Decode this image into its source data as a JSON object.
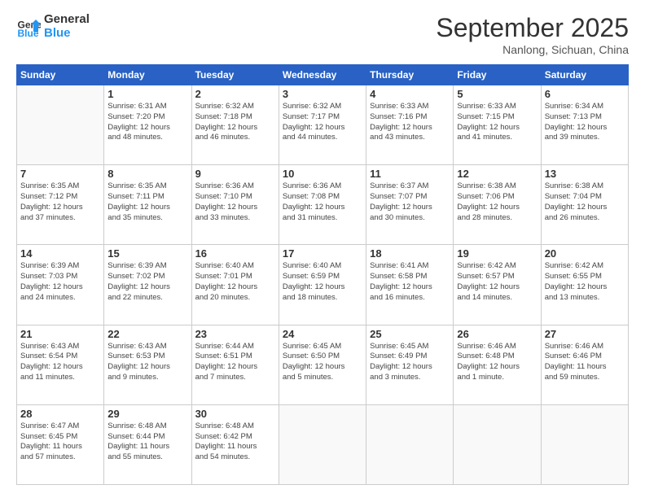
{
  "logo": {
    "line1": "General",
    "line2": "Blue"
  },
  "title": "September 2025",
  "location": "Nanlong, Sichuan, China",
  "weekdays": [
    "Sunday",
    "Monday",
    "Tuesday",
    "Wednesday",
    "Thursday",
    "Friday",
    "Saturday"
  ],
  "weeks": [
    [
      {
        "day": "",
        "info": ""
      },
      {
        "day": "1",
        "info": "Sunrise: 6:31 AM\nSunset: 7:20 PM\nDaylight: 12 hours\nand 48 minutes."
      },
      {
        "day": "2",
        "info": "Sunrise: 6:32 AM\nSunset: 7:18 PM\nDaylight: 12 hours\nand 46 minutes."
      },
      {
        "day": "3",
        "info": "Sunrise: 6:32 AM\nSunset: 7:17 PM\nDaylight: 12 hours\nand 44 minutes."
      },
      {
        "day": "4",
        "info": "Sunrise: 6:33 AM\nSunset: 7:16 PM\nDaylight: 12 hours\nand 43 minutes."
      },
      {
        "day": "5",
        "info": "Sunrise: 6:33 AM\nSunset: 7:15 PM\nDaylight: 12 hours\nand 41 minutes."
      },
      {
        "day": "6",
        "info": "Sunrise: 6:34 AM\nSunset: 7:13 PM\nDaylight: 12 hours\nand 39 minutes."
      }
    ],
    [
      {
        "day": "7",
        "info": "Sunrise: 6:35 AM\nSunset: 7:12 PM\nDaylight: 12 hours\nand 37 minutes."
      },
      {
        "day": "8",
        "info": "Sunrise: 6:35 AM\nSunset: 7:11 PM\nDaylight: 12 hours\nand 35 minutes."
      },
      {
        "day": "9",
        "info": "Sunrise: 6:36 AM\nSunset: 7:10 PM\nDaylight: 12 hours\nand 33 minutes."
      },
      {
        "day": "10",
        "info": "Sunrise: 6:36 AM\nSunset: 7:08 PM\nDaylight: 12 hours\nand 31 minutes."
      },
      {
        "day": "11",
        "info": "Sunrise: 6:37 AM\nSunset: 7:07 PM\nDaylight: 12 hours\nand 30 minutes."
      },
      {
        "day": "12",
        "info": "Sunrise: 6:38 AM\nSunset: 7:06 PM\nDaylight: 12 hours\nand 28 minutes."
      },
      {
        "day": "13",
        "info": "Sunrise: 6:38 AM\nSunset: 7:04 PM\nDaylight: 12 hours\nand 26 minutes."
      }
    ],
    [
      {
        "day": "14",
        "info": "Sunrise: 6:39 AM\nSunset: 7:03 PM\nDaylight: 12 hours\nand 24 minutes."
      },
      {
        "day": "15",
        "info": "Sunrise: 6:39 AM\nSunset: 7:02 PM\nDaylight: 12 hours\nand 22 minutes."
      },
      {
        "day": "16",
        "info": "Sunrise: 6:40 AM\nSunset: 7:01 PM\nDaylight: 12 hours\nand 20 minutes."
      },
      {
        "day": "17",
        "info": "Sunrise: 6:40 AM\nSunset: 6:59 PM\nDaylight: 12 hours\nand 18 minutes."
      },
      {
        "day": "18",
        "info": "Sunrise: 6:41 AM\nSunset: 6:58 PM\nDaylight: 12 hours\nand 16 minutes."
      },
      {
        "day": "19",
        "info": "Sunrise: 6:42 AM\nSunset: 6:57 PM\nDaylight: 12 hours\nand 14 minutes."
      },
      {
        "day": "20",
        "info": "Sunrise: 6:42 AM\nSunset: 6:55 PM\nDaylight: 12 hours\nand 13 minutes."
      }
    ],
    [
      {
        "day": "21",
        "info": "Sunrise: 6:43 AM\nSunset: 6:54 PM\nDaylight: 12 hours\nand 11 minutes."
      },
      {
        "day": "22",
        "info": "Sunrise: 6:43 AM\nSunset: 6:53 PM\nDaylight: 12 hours\nand 9 minutes."
      },
      {
        "day": "23",
        "info": "Sunrise: 6:44 AM\nSunset: 6:51 PM\nDaylight: 12 hours\nand 7 minutes."
      },
      {
        "day": "24",
        "info": "Sunrise: 6:45 AM\nSunset: 6:50 PM\nDaylight: 12 hours\nand 5 minutes."
      },
      {
        "day": "25",
        "info": "Sunrise: 6:45 AM\nSunset: 6:49 PM\nDaylight: 12 hours\nand 3 minutes."
      },
      {
        "day": "26",
        "info": "Sunrise: 6:46 AM\nSunset: 6:48 PM\nDaylight: 12 hours\nand 1 minute."
      },
      {
        "day": "27",
        "info": "Sunrise: 6:46 AM\nSunset: 6:46 PM\nDaylight: 11 hours\nand 59 minutes."
      }
    ],
    [
      {
        "day": "28",
        "info": "Sunrise: 6:47 AM\nSunset: 6:45 PM\nDaylight: 11 hours\nand 57 minutes."
      },
      {
        "day": "29",
        "info": "Sunrise: 6:48 AM\nSunset: 6:44 PM\nDaylight: 11 hours\nand 55 minutes."
      },
      {
        "day": "30",
        "info": "Sunrise: 6:48 AM\nSunset: 6:42 PM\nDaylight: 11 hours\nand 54 minutes."
      },
      {
        "day": "",
        "info": ""
      },
      {
        "day": "",
        "info": ""
      },
      {
        "day": "",
        "info": ""
      },
      {
        "day": "",
        "info": ""
      }
    ]
  ]
}
